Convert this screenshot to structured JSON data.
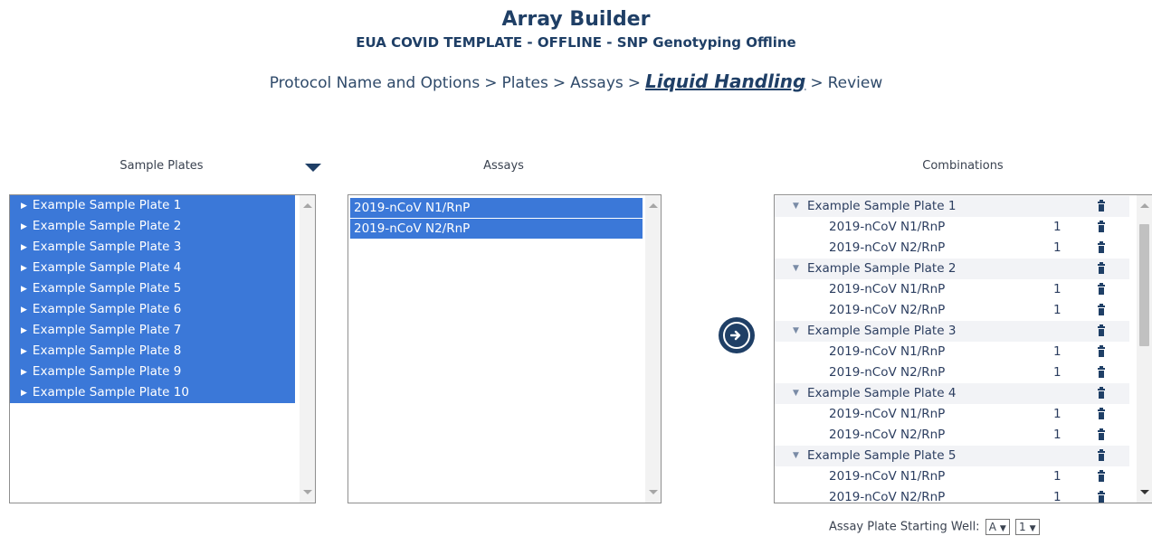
{
  "header": {
    "title": "Array Builder",
    "subtitle": "EUA COVID TEMPLATE - OFFLINE - SNP Genotyping Offline"
  },
  "breadcrumb": {
    "steps": [
      "Protocol Name and Options",
      "Plates",
      "Assays",
      "Liquid Handling",
      "Review"
    ],
    "separator": ">",
    "active": "Liquid Handling"
  },
  "sample_plates": {
    "label": "Sample Plates",
    "items": [
      "Example Sample Plate 1",
      "Example Sample Plate 2",
      "Example Sample Plate 3",
      "Example Sample Plate 4",
      "Example Sample Plate 5",
      "Example Sample Plate 6",
      "Example Sample Plate 7",
      "Example Sample Plate 8",
      "Example Sample Plate 9",
      "Example Sample Plate 10"
    ]
  },
  "assays": {
    "label": "Assays",
    "items": [
      "2019-nCoV N1/RnP",
      "2019-nCoV N2/RnP"
    ]
  },
  "combinations": {
    "label": "Combinations",
    "groups": [
      {
        "plate": "Example Sample Plate 1",
        "assays": [
          {
            "name": "2019-nCoV N1/RnP",
            "count": "1"
          },
          {
            "name": "2019-nCoV N2/RnP",
            "count": "1"
          }
        ]
      },
      {
        "plate": "Example Sample Plate 2",
        "assays": [
          {
            "name": "2019-nCoV N1/RnP",
            "count": "1"
          },
          {
            "name": "2019-nCoV N2/RnP",
            "count": "1"
          }
        ]
      },
      {
        "plate": "Example Sample Plate 3",
        "assays": [
          {
            "name": "2019-nCoV N1/RnP",
            "count": "1"
          },
          {
            "name": "2019-nCoV N2/RnP",
            "count": "1"
          }
        ]
      },
      {
        "plate": "Example Sample Plate 4",
        "assays": [
          {
            "name": "2019-nCoV N1/RnP",
            "count": "1"
          },
          {
            "name": "2019-nCoV N2/RnP",
            "count": "1"
          }
        ]
      },
      {
        "plate": "Example Sample Plate 5",
        "assays": [
          {
            "name": "2019-nCoV N1/RnP",
            "count": "1"
          },
          {
            "name": "2019-nCoV N2/RnP",
            "count": "1"
          }
        ]
      }
    ]
  },
  "starting_well": {
    "label": "Assay Plate Starting Well:",
    "row_value": "A",
    "col_value": "1"
  },
  "icons": {
    "plate_expand": "triangle-right-icon",
    "group_collapse": "triangle-down-icon",
    "delete": "trash-icon",
    "go": "arrow-circle-right-icon",
    "menu": "caret-down-icon"
  },
  "colors": {
    "selection": "#3b78d8",
    "brand": "#1f3f66",
    "group_row": "#f2f3f6"
  }
}
